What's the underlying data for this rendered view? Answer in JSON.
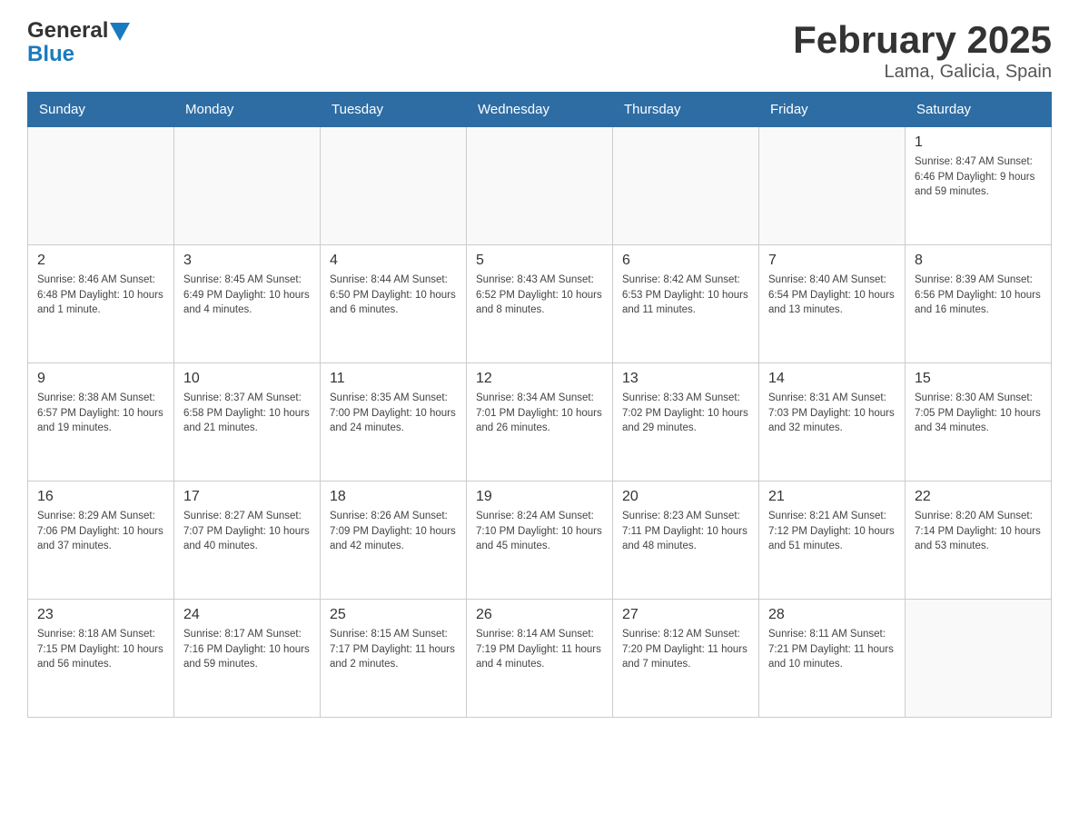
{
  "logo": {
    "general": "General",
    "blue": "Blue"
  },
  "title": "February 2025",
  "subtitle": "Lama, Galicia, Spain",
  "days_of_week": [
    "Sunday",
    "Monday",
    "Tuesday",
    "Wednesday",
    "Thursday",
    "Friday",
    "Saturday"
  ],
  "weeks": [
    [
      {
        "day": "",
        "info": ""
      },
      {
        "day": "",
        "info": ""
      },
      {
        "day": "",
        "info": ""
      },
      {
        "day": "",
        "info": ""
      },
      {
        "day": "",
        "info": ""
      },
      {
        "day": "",
        "info": ""
      },
      {
        "day": "1",
        "info": "Sunrise: 8:47 AM\nSunset: 6:46 PM\nDaylight: 9 hours and 59 minutes."
      }
    ],
    [
      {
        "day": "2",
        "info": "Sunrise: 8:46 AM\nSunset: 6:48 PM\nDaylight: 10 hours and 1 minute."
      },
      {
        "day": "3",
        "info": "Sunrise: 8:45 AM\nSunset: 6:49 PM\nDaylight: 10 hours and 4 minutes."
      },
      {
        "day": "4",
        "info": "Sunrise: 8:44 AM\nSunset: 6:50 PM\nDaylight: 10 hours and 6 minutes."
      },
      {
        "day": "5",
        "info": "Sunrise: 8:43 AM\nSunset: 6:52 PM\nDaylight: 10 hours and 8 minutes."
      },
      {
        "day": "6",
        "info": "Sunrise: 8:42 AM\nSunset: 6:53 PM\nDaylight: 10 hours and 11 minutes."
      },
      {
        "day": "7",
        "info": "Sunrise: 8:40 AM\nSunset: 6:54 PM\nDaylight: 10 hours and 13 minutes."
      },
      {
        "day": "8",
        "info": "Sunrise: 8:39 AM\nSunset: 6:56 PM\nDaylight: 10 hours and 16 minutes."
      }
    ],
    [
      {
        "day": "9",
        "info": "Sunrise: 8:38 AM\nSunset: 6:57 PM\nDaylight: 10 hours and 19 minutes."
      },
      {
        "day": "10",
        "info": "Sunrise: 8:37 AM\nSunset: 6:58 PM\nDaylight: 10 hours and 21 minutes."
      },
      {
        "day": "11",
        "info": "Sunrise: 8:35 AM\nSunset: 7:00 PM\nDaylight: 10 hours and 24 minutes."
      },
      {
        "day": "12",
        "info": "Sunrise: 8:34 AM\nSunset: 7:01 PM\nDaylight: 10 hours and 26 minutes."
      },
      {
        "day": "13",
        "info": "Sunrise: 8:33 AM\nSunset: 7:02 PM\nDaylight: 10 hours and 29 minutes."
      },
      {
        "day": "14",
        "info": "Sunrise: 8:31 AM\nSunset: 7:03 PM\nDaylight: 10 hours and 32 minutes."
      },
      {
        "day": "15",
        "info": "Sunrise: 8:30 AM\nSunset: 7:05 PM\nDaylight: 10 hours and 34 minutes."
      }
    ],
    [
      {
        "day": "16",
        "info": "Sunrise: 8:29 AM\nSunset: 7:06 PM\nDaylight: 10 hours and 37 minutes."
      },
      {
        "day": "17",
        "info": "Sunrise: 8:27 AM\nSunset: 7:07 PM\nDaylight: 10 hours and 40 minutes."
      },
      {
        "day": "18",
        "info": "Sunrise: 8:26 AM\nSunset: 7:09 PM\nDaylight: 10 hours and 42 minutes."
      },
      {
        "day": "19",
        "info": "Sunrise: 8:24 AM\nSunset: 7:10 PM\nDaylight: 10 hours and 45 minutes."
      },
      {
        "day": "20",
        "info": "Sunrise: 8:23 AM\nSunset: 7:11 PM\nDaylight: 10 hours and 48 minutes."
      },
      {
        "day": "21",
        "info": "Sunrise: 8:21 AM\nSunset: 7:12 PM\nDaylight: 10 hours and 51 minutes."
      },
      {
        "day": "22",
        "info": "Sunrise: 8:20 AM\nSunset: 7:14 PM\nDaylight: 10 hours and 53 minutes."
      }
    ],
    [
      {
        "day": "23",
        "info": "Sunrise: 8:18 AM\nSunset: 7:15 PM\nDaylight: 10 hours and 56 minutes."
      },
      {
        "day": "24",
        "info": "Sunrise: 8:17 AM\nSunset: 7:16 PM\nDaylight: 10 hours and 59 minutes."
      },
      {
        "day": "25",
        "info": "Sunrise: 8:15 AM\nSunset: 7:17 PM\nDaylight: 11 hours and 2 minutes."
      },
      {
        "day": "26",
        "info": "Sunrise: 8:14 AM\nSunset: 7:19 PM\nDaylight: 11 hours and 4 minutes."
      },
      {
        "day": "27",
        "info": "Sunrise: 8:12 AM\nSunset: 7:20 PM\nDaylight: 11 hours and 7 minutes."
      },
      {
        "day": "28",
        "info": "Sunrise: 8:11 AM\nSunset: 7:21 PM\nDaylight: 11 hours and 10 minutes."
      },
      {
        "day": "",
        "info": ""
      }
    ]
  ]
}
